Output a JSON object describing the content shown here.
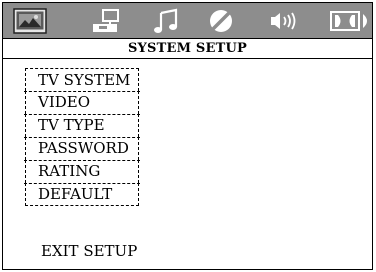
{
  "tabs": [
    {
      "icon": "tv-setup-icon"
    },
    {
      "icon": "monitor-settings-icon"
    },
    {
      "icon": "music-note-icon"
    },
    {
      "icon": "circle-slash-icon"
    },
    {
      "icon": "speaker-icon"
    },
    {
      "icon": "dolby-icon"
    }
  ],
  "header": {
    "title": "SYSTEM SETUP"
  },
  "menu": {
    "items": [
      "TV SYSTEM",
      "VIDEO",
      "TV TYPE",
      "PASSWORD",
      "RATING",
      "DEFAULT"
    ],
    "exit_label": "EXIT SETUP"
  },
  "colors": {
    "tabbar_bg": "#8d8d8d",
    "active_tab_fg": "#3a3a3a",
    "icon_fg": "#ffffff"
  }
}
